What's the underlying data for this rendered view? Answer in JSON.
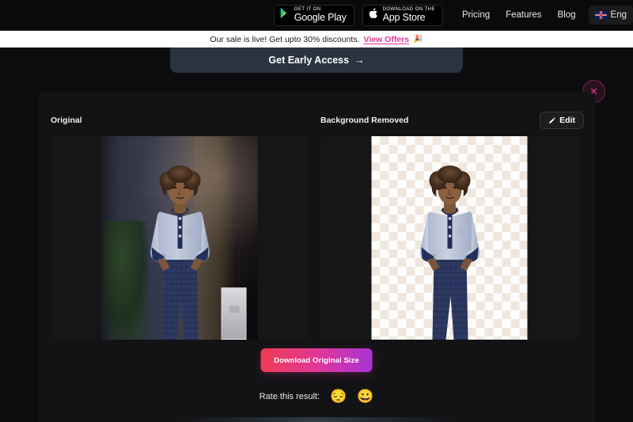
{
  "nav": {
    "google_play": {
      "small": "GET IT ON",
      "big": "Google Play",
      "icon": "google-play-icon"
    },
    "app_store": {
      "small": "Download on the",
      "big": "App Store",
      "icon": "apple-icon"
    },
    "links": [
      {
        "label": "Pricing"
      },
      {
        "label": "Features"
      },
      {
        "label": "Blog"
      }
    ],
    "language": {
      "label": "Eng",
      "flag": "uk-flag-icon"
    }
  },
  "announcement": {
    "message": "Our sale is live! Get upto 30% discounts.",
    "link_label": "View Offers",
    "emoji": "🎉",
    "background": "#ffffff",
    "link_color": "#e0379a"
  },
  "early_access": {
    "label": "Get Early Access",
    "arrow": "→",
    "background": "#2a3440"
  },
  "close": {
    "glyph": "✕",
    "color": "#e0379a"
  },
  "card": {
    "original_label": "Original",
    "removed_label": "Background Removed",
    "edit": {
      "label": "Edit",
      "icon": "pencil-icon"
    }
  },
  "download": {
    "label": "Download Original Size",
    "gradient_from": "#ef3b4e",
    "gradient_mid": "#e0379a",
    "gradient_to": "#a533d6"
  },
  "rating": {
    "label": "Rate this result:",
    "options": [
      {
        "emoji": "😔",
        "name": "sad-face"
      },
      {
        "emoji": "😀",
        "name": "happy-face"
      }
    ]
  },
  "theme": {
    "page_background": "#0c0c0e",
    "card_background": "#131315",
    "pane_background": "#161618"
  }
}
